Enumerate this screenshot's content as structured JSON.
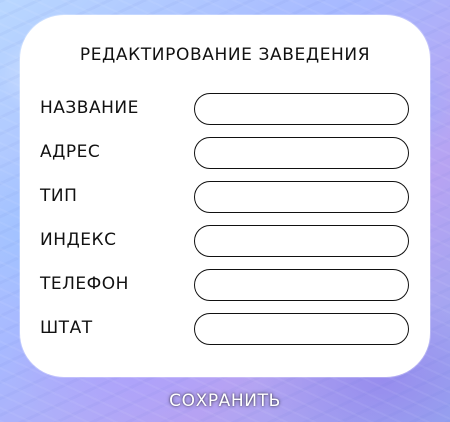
{
  "form": {
    "title": "РЕДАКТИРОВАНИЕ ЗАВЕДЕНИЯ",
    "fields": [
      {
        "label": "НАЗВАНИЕ",
        "value": "",
        "placeholder": ""
      },
      {
        "label": "АДРЕС",
        "value": "",
        "placeholder": ""
      },
      {
        "label": "ТИП",
        "value": "",
        "placeholder": ""
      },
      {
        "label": "ИНДЕКС",
        "value": "",
        "placeholder": ""
      },
      {
        "label": "ТЕЛЕФОН",
        "value": "",
        "placeholder": ""
      },
      {
        "label": "ШТАТ",
        "value": "",
        "placeholder": ""
      }
    ],
    "save_label": "СОХРАНИТЬ"
  },
  "colors": {
    "card_background": "#ffffff",
    "text": "#111111",
    "field_border": "#111111",
    "save_text": "#ffffff"
  }
}
